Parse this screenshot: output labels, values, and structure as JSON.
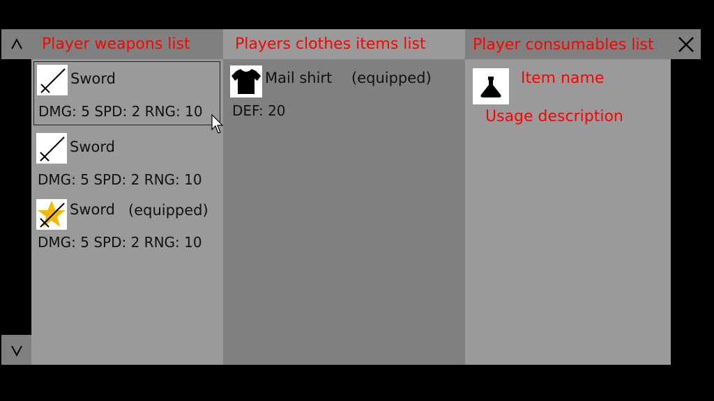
{
  "controls": {
    "scroll_up_icon": "chevron-up-icon",
    "scroll_down_icon": "chevron-down-icon",
    "close_icon": "close-icon"
  },
  "weapons": {
    "header": "Player weapons list",
    "items": [
      {
        "name": "Sword",
        "equipped_label": "",
        "stats": "DMG: 5 SPD: 2 RNG: 10",
        "selected": true,
        "icon": "sword-icon"
      },
      {
        "name": "Sword",
        "equipped_label": "",
        "stats": "DMG: 5 SPD: 2 RNG: 10",
        "selected": false,
        "icon": "sword-icon"
      },
      {
        "name": "Sword",
        "equipped_label": "(equipped)",
        "stats": "DMG: 5 SPD: 2 RNG: 10",
        "selected": false,
        "icon": "sword-star-icon"
      }
    ]
  },
  "clothes": {
    "header": "Players clothes items list",
    "items": [
      {
        "name": "Mail shirt",
        "equipped_label": "(equipped)",
        "stats": "DEF: 20",
        "icon": "shirt-icon"
      }
    ]
  },
  "consumables": {
    "header": "Player consumables list",
    "item_name": "Item name",
    "usage_description": "Usage description",
    "icon": "flask-icon"
  },
  "colors": {
    "accent_text": "#ff0000",
    "star": "#f5b800",
    "panel_light": "#9a9a9a",
    "panel_dark": "#808080",
    "background": "#000000"
  }
}
